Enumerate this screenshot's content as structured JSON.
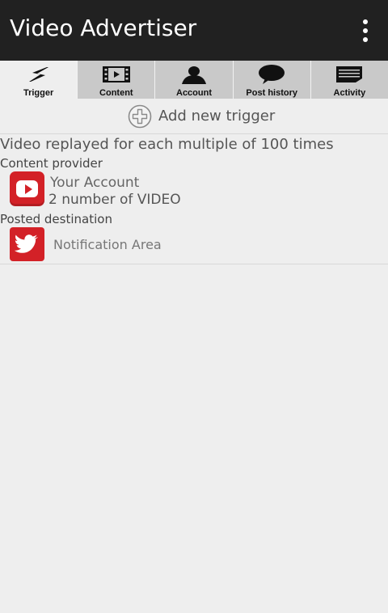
{
  "app": {
    "title": "Video Advertiser",
    "overflow_icon": "more-vert-icon"
  },
  "tabs": [
    {
      "label": "Trigger",
      "icon": "lightning-icon",
      "active": true
    },
    {
      "label": "Content",
      "icon": "film-icon",
      "active": false
    },
    {
      "label": "Account",
      "icon": "person-icon",
      "active": false
    },
    {
      "label": "Post history",
      "icon": "speech-bubble-icon",
      "active": false
    },
    {
      "label": "Activity",
      "icon": "notepad-icon",
      "active": false
    }
  ],
  "add_trigger": {
    "label": "Add new trigger",
    "icon": "add-circle-icon"
  },
  "trigger": {
    "summary": "Video replayed for each multiple of 100 times",
    "content_provider_label": "Content provider",
    "provider_icon": "youtube-icon",
    "account_name": "Your Account",
    "account_detail": "2 number of VIDEO",
    "posted_destination_label": "Posted destination",
    "destination_icon": "twitter-icon",
    "destination_name": "Notification Area"
  },
  "colors": {
    "appbar": "#212121",
    "background": "#eeeeee",
    "tab_inactive": "#c9c9c9",
    "brand_red": "#d32127"
  }
}
